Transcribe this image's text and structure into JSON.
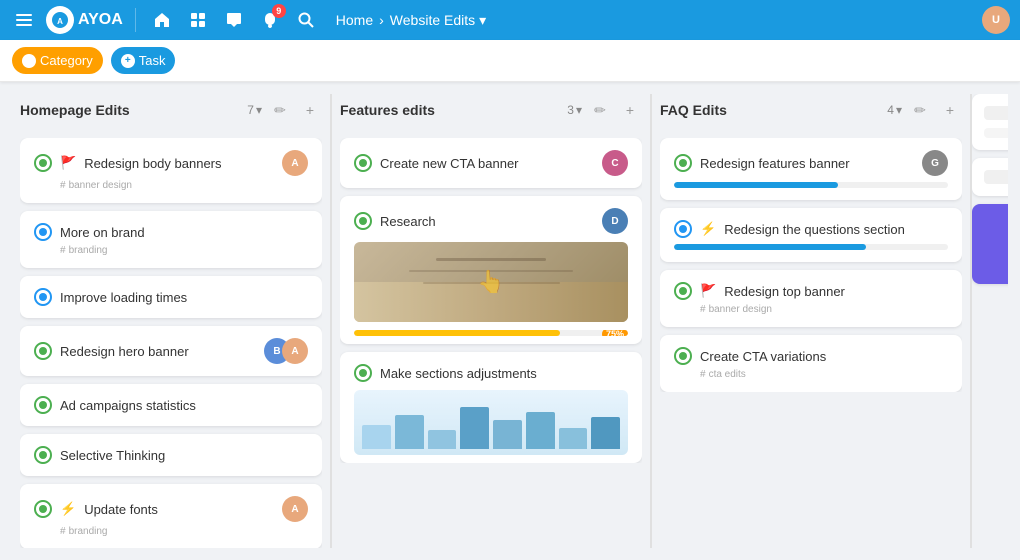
{
  "nav": {
    "logo_text": "AYOA",
    "home_label": "Home",
    "arrow": "›",
    "current_page": "Website Edits",
    "dropdown_icon": "▾",
    "badge_count": "9"
  },
  "sub_nav": {
    "category_label": "Category",
    "task_label": "Task"
  },
  "columns": [
    {
      "id": "homepage-edits",
      "title": "Homepage Edits",
      "count": "7",
      "cards": [
        {
          "id": "redesign-body",
          "title": "Redesign body banners",
          "tag": "banner design",
          "emoji": "🚩",
          "status": "done",
          "has_avatar": true,
          "avatar_color": "#e8a87c"
        },
        {
          "id": "more-on-brand",
          "title": "More on brand",
          "tag": "branding",
          "status": "in-progress",
          "has_avatar": false
        },
        {
          "id": "improve-loading",
          "title": "Improve loading times",
          "tag": "",
          "status": "in-progress",
          "has_avatar": false
        },
        {
          "id": "redesign-hero",
          "title": "Redesign hero banner",
          "tag": "",
          "status": "done",
          "has_avatar": true,
          "avatar_color": "#5b8dd9",
          "avatar_color2": "#e8a87c"
        },
        {
          "id": "ad-campaigns",
          "title": "Ad campaigns statistics",
          "tag": "",
          "status": "done",
          "has_avatar": false
        },
        {
          "id": "selective-thinking",
          "title": "Selective Thinking",
          "tag": "",
          "status": "done",
          "has_avatar": false
        },
        {
          "id": "update-fonts",
          "title": "Update fonts",
          "tag": "branding",
          "emoji": "⚡",
          "status": "done",
          "has_avatar": true,
          "avatar_color": "#e8a87c"
        }
      ]
    },
    {
      "id": "features-edits",
      "title": "Features edits",
      "count": "3",
      "cards": [
        {
          "id": "create-new-banner",
          "title": "Create new CTA banner",
          "tag": "",
          "status": "done",
          "has_avatar": true,
          "avatar_color": "#c85b8a",
          "has_image": false
        },
        {
          "id": "research",
          "title": "Research",
          "tag": "",
          "status": "done",
          "has_avatar": true,
          "avatar_color": "#4a7fb5",
          "has_image": true,
          "image_type": "hands",
          "progress": 75,
          "progress_color": "#ffc107"
        },
        {
          "id": "make-sections",
          "title": "Make sections adjustments",
          "tag": "",
          "status": "done",
          "has_avatar": false,
          "has_image": true,
          "image_type": "charts"
        }
      ]
    },
    {
      "id": "faq-edits",
      "title": "FAQ Edits",
      "count": "4",
      "cards": [
        {
          "id": "redesign-features-banner",
          "title": "Redesign features banner",
          "tag": "",
          "status": "done",
          "has_avatar": true,
          "avatar_color": "#888",
          "progress": 60,
          "progress_color": "#1a9ae0"
        },
        {
          "id": "redesign-questions",
          "title": "Redesign the questions section",
          "tag": "",
          "emoji": "⚡",
          "status": "in-progress",
          "has_avatar": false,
          "progress": 70,
          "progress_color": "#1a9ae0"
        },
        {
          "id": "redesign-top-banner",
          "title": "Redesign top banner",
          "tag": "banner design",
          "emoji": "🚩",
          "status": "done",
          "has_avatar": false
        },
        {
          "id": "create-cta-variations",
          "title": "Create CTA variations",
          "tag": "cta edits",
          "status": "done",
          "has_avatar": false
        }
      ]
    }
  ],
  "icons": {
    "menu": "☰",
    "home": "🏠",
    "grid": "⊞",
    "chat": "✉",
    "bell": "🔔",
    "search": "🔍",
    "pencil": "✏",
    "plus": "+",
    "chevron_down": "▾",
    "link": "⊘",
    "tag": "#"
  }
}
